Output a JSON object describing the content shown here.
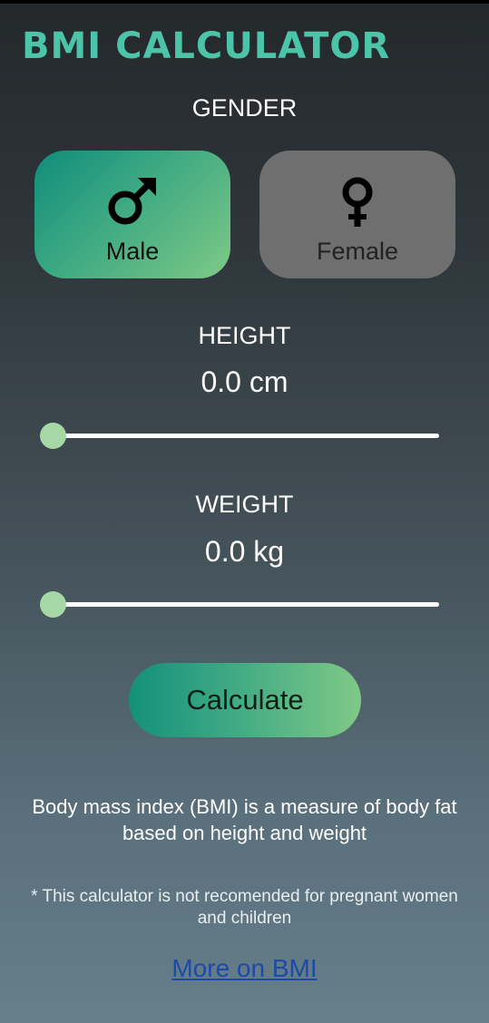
{
  "app": {
    "title": "BMI CALCULATOR"
  },
  "gender": {
    "label": "GENDER",
    "options": [
      {
        "label": "Male",
        "icon": "male-symbol-icon",
        "selected": true
      },
      {
        "label": "Female",
        "icon": "female-symbol-icon",
        "selected": false
      }
    ]
  },
  "height": {
    "label": "HEIGHT",
    "value_text": "0.0 cm",
    "slider_level": 0
  },
  "weight": {
    "label": "WEIGHT",
    "value_text": "0.0 kg",
    "slider_level": 0
  },
  "calculate": {
    "label": "Calculate"
  },
  "info": {
    "description": "Body mass index (BMI) is a measure of body fat based on height and weight",
    "note": "* This calculator is not recomended for pregnant women and children",
    "link": "More on BMI"
  },
  "colors": {
    "accent": "#4cc4a8",
    "selected_gradient_start": "#0f8c7a",
    "selected_gradient_end": "#7ec986",
    "unselected": "#6f6f6f",
    "slider_thumb": "#a6d8a6",
    "link": "#1c4aa8"
  }
}
